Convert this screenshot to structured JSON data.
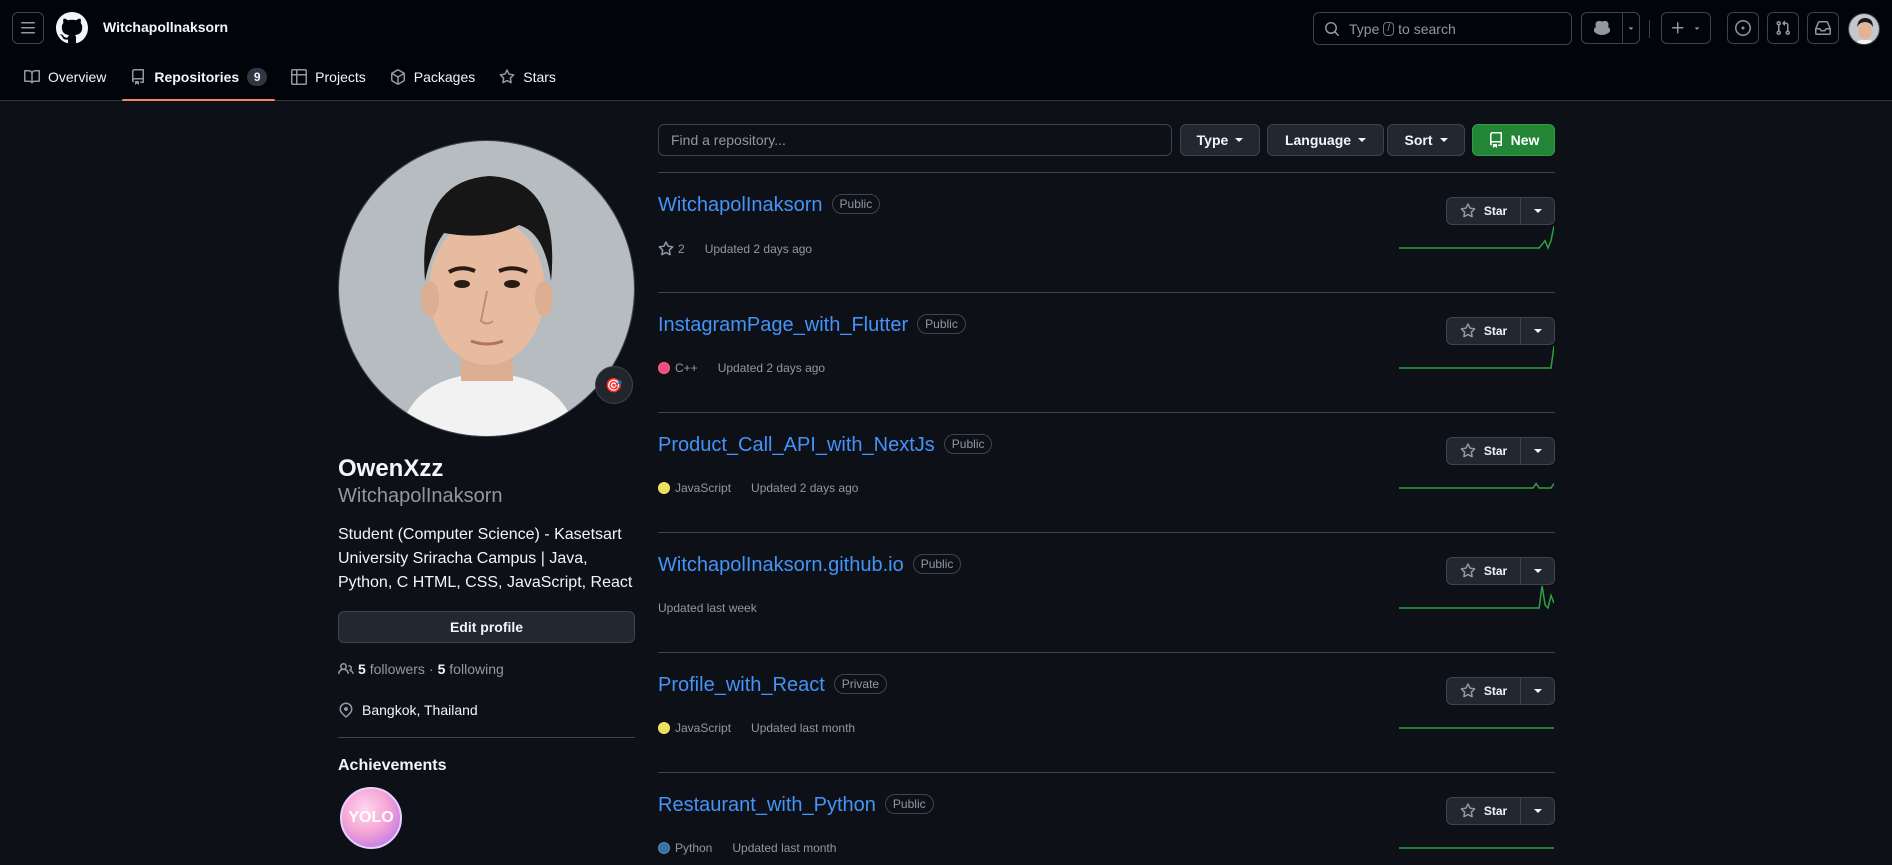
{
  "header": {
    "username": "Witchapollnaksorn",
    "search_placeholder_pre": "Type",
    "search_key": "/",
    "search_placeholder_post": "to search"
  },
  "tabs": [
    {
      "label": "Overview",
      "icon": "book-icon"
    },
    {
      "label": "Repositories",
      "icon": "repo-icon",
      "count": "9",
      "selected": true
    },
    {
      "label": "Projects",
      "icon": "table-icon"
    },
    {
      "label": "Packages",
      "icon": "package-icon"
    },
    {
      "label": "Stars",
      "icon": "star-icon"
    }
  ],
  "profile": {
    "display_name": "OwenXzz",
    "login": "WitchapolInaksorn",
    "bio": "Student (Computer Science) - Kasetsart University Sriracha Campus | Java, Python, C HTML, CSS, JavaScript, React",
    "edit_label": "Edit profile",
    "followers_count": "5",
    "followers_label": "followers",
    "following_count": "5",
    "following_label": "following",
    "dot": "·",
    "location": "Bangkok, Thailand",
    "achievements_title": "Achievements",
    "achievement_badge_text": "YOLO",
    "status_emoji": "🎯"
  },
  "filters": {
    "find_placeholder": "Find a repository...",
    "type_label": "Type",
    "language_label": "Language",
    "sort_label": "Sort",
    "new_label": "New"
  },
  "repos": [
    {
      "name": "WitchapolInaksorn",
      "visibility": "Public",
      "language": "",
      "lang_color": "",
      "stars": "2",
      "updated": "Updated 2 days ago",
      "activity": [
        0,
        0,
        0,
        0,
        0,
        0,
        0,
        0,
        0,
        0,
        0,
        0,
        0,
        0,
        0,
        0,
        0,
        0,
        0,
        0,
        0,
        0,
        0,
        0,
        0,
        0,
        0,
        0,
        0,
        0,
        0,
        0,
        0,
        0,
        0,
        0,
        0,
        0,
        0,
        0,
        0,
        0,
        0,
        0,
        0,
        0,
        0,
        0,
        1,
        2,
        0,
        2,
        6
      ]
    },
    {
      "name": "InstagramPage_with_Flutter",
      "visibility": "Public",
      "language": "C++",
      "lang_color": "#f34b7d",
      "stars": "",
      "updated": "Updated 2 days ago",
      "activity": [
        0,
        0,
        0,
        0,
        0,
        0,
        0,
        0,
        0,
        0,
        0,
        0,
        0,
        0,
        0,
        0,
        0,
        0,
        0,
        0,
        0,
        0,
        0,
        0,
        0,
        0,
        0,
        0,
        0,
        0,
        0,
        0,
        0,
        0,
        0,
        0,
        0,
        0,
        0,
        0,
        0,
        0,
        0,
        0,
        0,
        0,
        0,
        0,
        0,
        0,
        0,
        0,
        8
      ]
    },
    {
      "name": "Product_Call_API_with_NextJs",
      "visibility": "Public",
      "language": "JavaScript",
      "lang_color": "#f1e05a",
      "stars": "",
      "updated": "Updated 2 days ago",
      "activity": [
        0,
        0,
        0,
        0,
        0,
        0,
        0,
        0,
        0,
        0,
        0,
        0,
        0,
        0,
        0,
        0,
        0,
        0,
        0,
        0,
        0,
        0,
        0,
        0,
        0,
        0,
        0,
        0,
        0,
        0,
        0,
        0,
        0,
        0,
        0,
        0,
        0,
        0,
        0,
        0,
        0,
        0,
        0,
        0,
        0,
        0,
        1,
        0,
        0,
        0,
        0,
        0,
        1
      ]
    },
    {
      "name": "WitchapolInaksorn.github.io",
      "visibility": "Public",
      "language": "",
      "lang_color": "",
      "stars": "",
      "updated": "Updated last week",
      "activity": [
        0,
        0,
        0,
        0,
        0,
        0,
        0,
        0,
        0,
        0,
        0,
        0,
        0,
        0,
        0,
        0,
        0,
        0,
        0,
        0,
        0,
        0,
        0,
        0,
        0,
        0,
        0,
        0,
        0,
        0,
        0,
        0,
        0,
        0,
        0,
        0,
        0,
        0,
        0,
        0,
        0,
        0,
        0,
        0,
        0,
        0,
        0,
        0,
        14,
        2,
        0,
        8,
        3
      ]
    },
    {
      "name": "Profile_with_React",
      "visibility": "Private",
      "language": "JavaScript",
      "lang_color": "#f1e05a",
      "stars": "",
      "updated": "Updated last month",
      "activity": [
        0,
        0,
        0,
        0,
        0,
        0,
        0,
        0,
        0,
        0,
        0,
        0,
        0,
        0,
        0,
        0,
        0,
        0,
        0,
        0,
        0,
        0,
        0,
        0,
        0,
        0,
        0,
        0,
        0,
        0,
        0,
        0,
        0,
        0,
        0,
        0,
        0,
        0,
        0,
        0,
        0,
        0,
        0,
        0,
        0,
        0,
        0,
        0,
        0,
        0,
        0,
        0,
        0
      ]
    },
    {
      "name": "Restaurant_with_Python",
      "visibility": "Public",
      "language": "Python",
      "lang_color": "#3572A5",
      "stars": "",
      "updated": "Updated last month",
      "activity": [
        0,
        0,
        0,
        0,
        0,
        0,
        0,
        0,
        0,
        0,
        0,
        0,
        0,
        0,
        0,
        0,
        0,
        0,
        0,
        0,
        0,
        0,
        0,
        0,
        0,
        0,
        0,
        0,
        0,
        0,
        0,
        0,
        0,
        0,
        0,
        0,
        0,
        0,
        0,
        0,
        0,
        0,
        0,
        0,
        0,
        0,
        0,
        0,
        0,
        0,
        0,
        0,
        0
      ]
    }
  ],
  "star_label": "Star",
  "colors": {
    "accent_link": "#4493f8",
    "new_button": "#238636",
    "tab_underline": "#f78166",
    "sparkline": "#2ea043"
  }
}
